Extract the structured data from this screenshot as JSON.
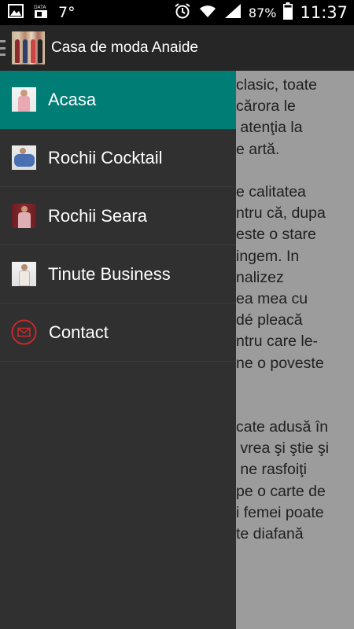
{
  "status_bar": {
    "temperature": "7°",
    "battery_percent": "87%",
    "time": "11:37",
    "icons": [
      "gallery-icon",
      "data-sim-icon",
      "alarm-icon",
      "wifi-icon",
      "signal-icon",
      "battery-icon"
    ]
  },
  "app_bar": {
    "title": "Casa de moda Anaide",
    "icons": [
      "menu-icon",
      "app-logo-image"
    ]
  },
  "drawer": {
    "items": [
      {
        "label": "Acasa",
        "icon": "dress-photo-thumbnail",
        "active": true
      },
      {
        "label": "Rochii Cocktail",
        "icon": "dress-photo-thumbnail",
        "active": false
      },
      {
        "label": "Rochii Seara",
        "icon": "dress-photo-thumbnail",
        "active": false
      },
      {
        "label": "Tinute Business",
        "icon": "dress-photo-thumbnail",
        "active": false
      },
      {
        "label": "Contact",
        "icon": "mail-icon",
        "active": false
      }
    ]
  },
  "background_text": {
    "paragraph_1": "clasic, toate\ncărora le\n atenţia la\ne artă.",
    "paragraph_2": "e calitatea\nntru că, dupa\neste o stare\ningem. In\nnalizez\nea mea cu\ndé pleacă\nntru care le-\nne o poveste",
    "paragraph_3": "cate adusă în\n vrea şi ştie şi\n ne rasfoiţi\npe o carte de\ni femei poate\nte diafană"
  },
  "colors": {
    "accent": "#007d75",
    "drawer_bg": "#303030",
    "app_bar_bg": "#262626",
    "dim_content_bg": "#9c9c9c",
    "contact_icon": "#c8282d"
  }
}
